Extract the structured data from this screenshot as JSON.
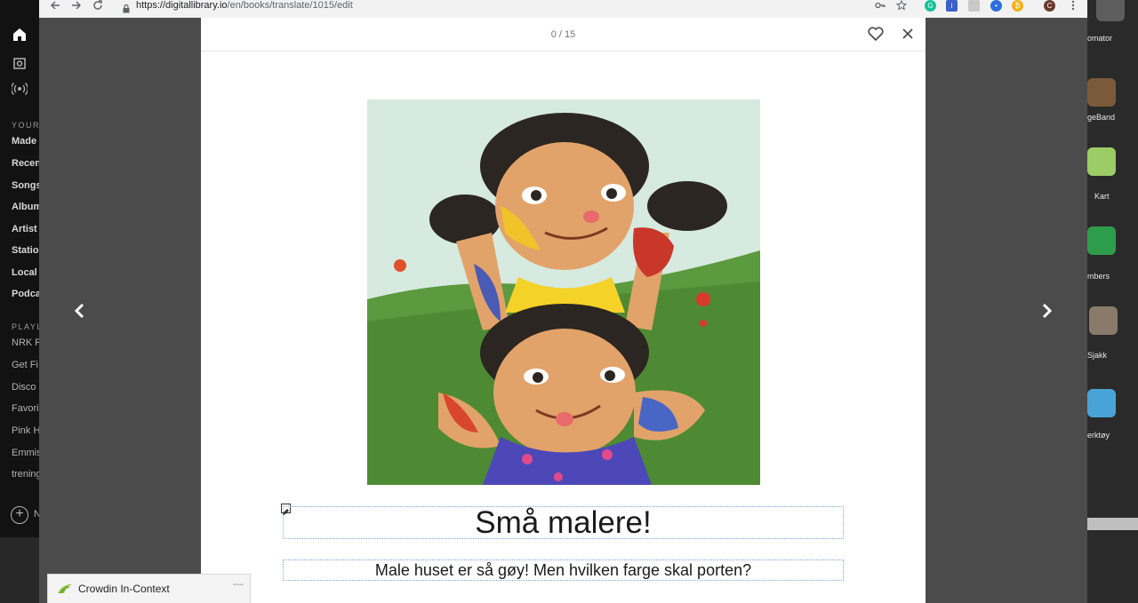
{
  "sidebar": {
    "section_library": "YOUR",
    "library_items": [
      "Made",
      "Recen",
      "Songs",
      "Album",
      "Artist",
      "Statio",
      "Local",
      "Podca"
    ],
    "section_playlists": "PLAYL",
    "playlist_items": [
      "NRK F",
      "Get Fi",
      "Disco",
      "Favori",
      "Pink H",
      "Emmis",
      "trening"
    ],
    "new_playlist_label": "N"
  },
  "browser": {
    "url_host": "https://digitallibrary.io",
    "url_path": "/en/books/translate/1015/edit"
  },
  "reader": {
    "page_counter": "0 / 15",
    "title": "Små malere!",
    "subtitle": "Male huset er så gøy! Men hvilken farge skal porten?"
  },
  "crowdin": {
    "label": "Crowdin In-Context"
  },
  "dock": {
    "apps": [
      "omator",
      "geBand",
      "Kart",
      "mbers",
      "Sjakk",
      "erktøy"
    ]
  },
  "colors": {
    "accent_grammarly": "#15c39a",
    "reader_bg": "#ffffff",
    "overlay": "#4b4b4b"
  }
}
